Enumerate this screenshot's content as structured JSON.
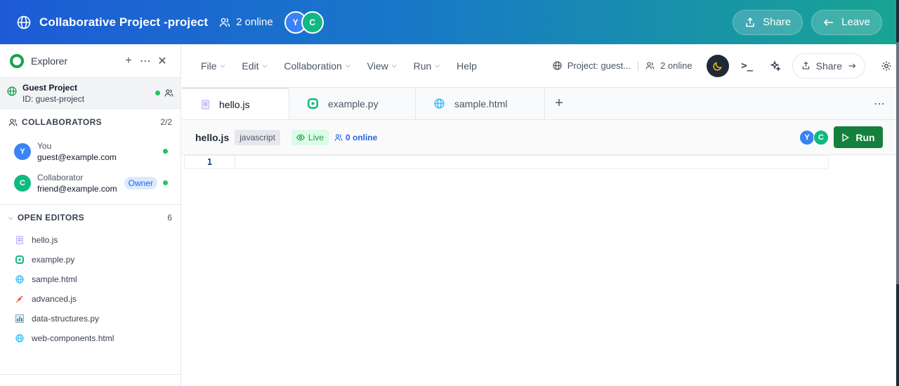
{
  "header": {
    "title": "Collaborative Project -project",
    "online": "2 online",
    "avatars": [
      "Y",
      "C"
    ],
    "share_label": "Share",
    "leave_label": "Leave"
  },
  "sidebar": {
    "title": "Explorer",
    "project": {
      "name": "Guest Project",
      "id": "ID: guest-project"
    },
    "collaborators": {
      "heading": "COLLABORATORS",
      "count": "2/2",
      "items": [
        {
          "initial": "Y",
          "name": "You",
          "email": "guest@example.com"
        },
        {
          "initial": "C",
          "name": "Collaborator",
          "email": "friend@example.com",
          "badge": "Owner"
        }
      ]
    },
    "open_editors": {
      "heading": "OPEN EDITORS",
      "count": "6",
      "files": [
        "hello.js",
        "example.py",
        "sample.html",
        "advanced.js",
        "data-structures.py",
        "web-components.html"
      ]
    }
  },
  "menubar": {
    "menus": [
      "File",
      "Edit",
      "Collaboration",
      "View",
      "Run",
      "Help"
    ],
    "project": "Project: guest...",
    "online": "2 online",
    "share_label": "Share"
  },
  "tabs": [
    "hello.js",
    "example.py",
    "sample.html"
  ],
  "filebar": {
    "name": "hello.js",
    "language": "javascript",
    "live": "Live",
    "online": "0 online",
    "avatars": [
      "Y",
      "C"
    ],
    "run_label": "Run"
  },
  "editor": {
    "line_number": "1"
  },
  "colors": {
    "accent": "#1d5bd6",
    "teal": "#18a592",
    "run": "#15803d",
    "online_dot": "#22c55e"
  }
}
